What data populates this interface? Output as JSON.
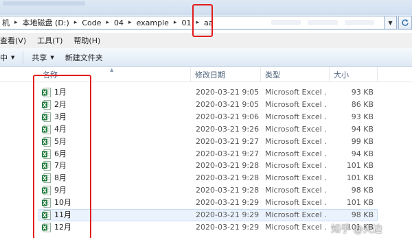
{
  "address_bar": {
    "crumbs": [
      "机",
      "本地磁盘 (D:)",
      "Code",
      "04",
      "example",
      "01",
      "aa"
    ]
  },
  "menu": {
    "items": [
      "查看(V)",
      "工具(T)",
      "帮助(H)"
    ]
  },
  "toolbar": {
    "left_item": "中",
    "share_label": "共享",
    "new_folder_label": "新建文件夹"
  },
  "columns": {
    "name": "名称",
    "modified": "修改日期",
    "type": "类型",
    "size": "大小"
  },
  "files": [
    {
      "name": "1月",
      "modified": "2020-03-21 9:05",
      "type": "Microsoft Excel ...",
      "size": "93 KB"
    },
    {
      "name": "2月",
      "modified": "2020-03-21 9:05",
      "type": "Microsoft Excel ...",
      "size": "86 KB"
    },
    {
      "name": "3月",
      "modified": "2020-03-21 9:06",
      "type": "Microsoft Excel ...",
      "size": "93 KB"
    },
    {
      "name": "4月",
      "modified": "2020-03-21 9:26",
      "type": "Microsoft Excel ...",
      "size": "94 KB"
    },
    {
      "name": "5月",
      "modified": "2020-03-21 9:27",
      "type": "Microsoft Excel ...",
      "size": "99 KB"
    },
    {
      "name": "6月",
      "modified": "2020-03-21 9:27",
      "type": "Microsoft Excel ...",
      "size": "94 KB"
    },
    {
      "name": "7月",
      "modified": "2020-03-21 9:28",
      "type": "Microsoft Excel ...",
      "size": "101 KB"
    },
    {
      "name": "8月",
      "modified": "2020-03-21 9:28",
      "type": "Microsoft Excel ...",
      "size": "101 KB"
    },
    {
      "name": "9月",
      "modified": "2020-03-21 9:28",
      "type": "Microsoft Excel ...",
      "size": "98 KB"
    },
    {
      "name": "10月",
      "modified": "2020-03-21 9:29",
      "type": "Microsoft Excel ...",
      "size": "101 KB"
    },
    {
      "name": "11月",
      "modified": "2020-03-21 9:29",
      "type": "Microsoft Excel ...",
      "size": "98 KB"
    },
    {
      "name": "12月",
      "modified": "2020-03-21 9:29",
      "type": "Microsoft Excel ...",
      "size": "101 KB"
    }
  ],
  "selected_index": 10,
  "watermark": "知乎 @天边",
  "colors": {
    "annotation_red": "#e21c1c",
    "excel_green": "#1f7a3a",
    "selection": "#eaf3fd"
  },
  "icons": {
    "file": "excel-file-icon",
    "refresh": "refresh-icon",
    "dropdown": "chevron-down-icon"
  }
}
